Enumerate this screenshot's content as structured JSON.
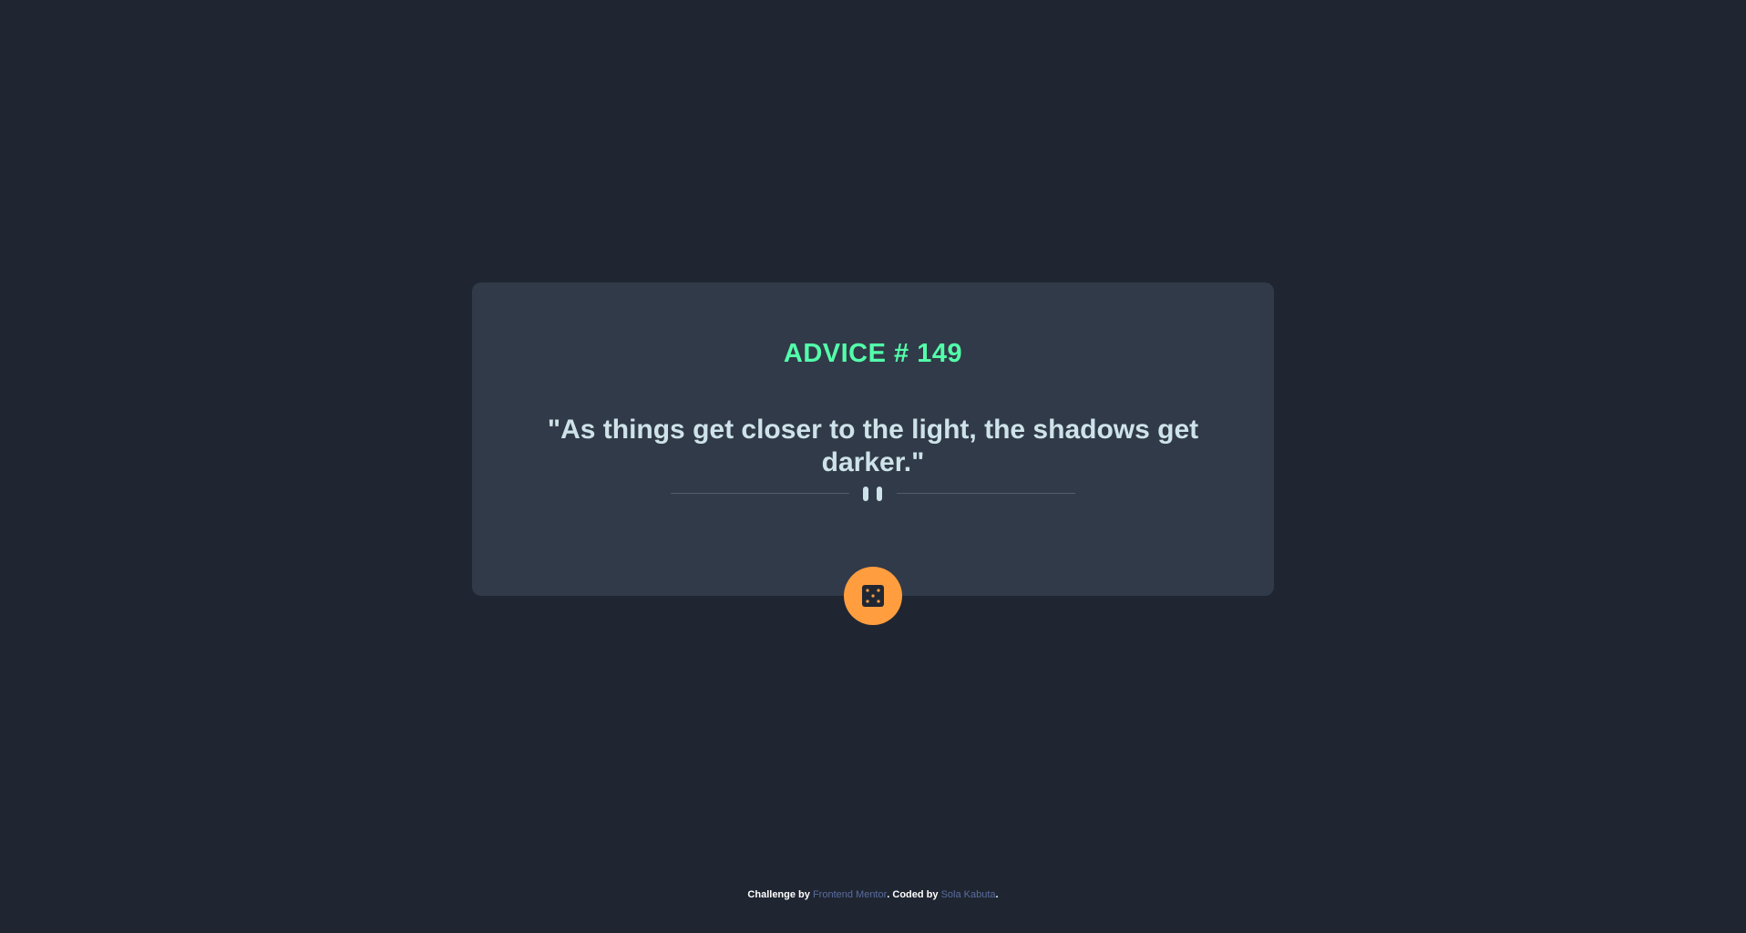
{
  "advice": {
    "id_label": "ADVICE # 149",
    "quote": "\"As things get closer to the light, the shadows get darker.\""
  },
  "divider": {
    "icon": "pause-icon"
  },
  "button": {
    "icon": "dice-icon",
    "color": "#ff9d3f"
  },
  "footer": {
    "prefix": "Challenge by ",
    "link1": "Frontend Mentor",
    "middle": ". Coded by ",
    "link2": "Sola Kabuta",
    "suffix": "."
  },
  "colors": {
    "background": "#1f2631",
    "card": "#313a48",
    "accent": "#53ffaa",
    "text": "#cee3e9"
  }
}
